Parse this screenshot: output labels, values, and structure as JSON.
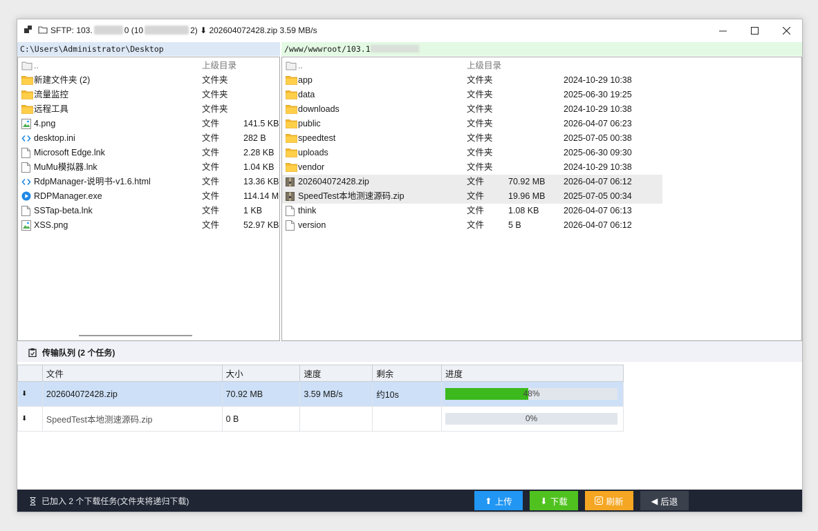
{
  "window": {
    "title_prefix": "SFTP: 103.",
    "title_mid": "0 (10",
    "title_suffix": "2) ⬇ 202604072428.zip 3.59 MB/s",
    "minimize": "—",
    "maximize": "☐",
    "close": "✕"
  },
  "paths": {
    "local": "C:\\Users\\Administrator\\Desktop",
    "remote": "/www/wwwroot/103.1"
  },
  "local_files": [
    {
      "name": "..",
      "type": "上级目录",
      "size": "",
      "icon": "parent-folder-icon"
    },
    {
      "name": "新建文件夹 (2)",
      "type": "文件夹",
      "size": "",
      "icon": "folder-icon"
    },
    {
      "name": "流量监控",
      "type": "文件夹",
      "size": "",
      "icon": "folder-icon"
    },
    {
      "name": "远程工具",
      "type": "文件夹",
      "size": "",
      "icon": "folder-icon"
    },
    {
      "name": "4.png",
      "type": "文件",
      "size": "141.5 KB",
      "icon": "image-file-icon"
    },
    {
      "name": "desktop.ini",
      "type": "文件",
      "size": "282 B",
      "icon": "code-file-icon"
    },
    {
      "name": "Microsoft Edge.lnk",
      "type": "文件",
      "size": "2.28 KB",
      "icon": "file-icon"
    },
    {
      "name": "MuMu模拟器.lnk",
      "type": "文件",
      "size": "1.04 KB",
      "icon": "file-icon"
    },
    {
      "name": "RdpManager-说明书-v1.6.html",
      "type": "文件",
      "size": "13.36 KB",
      "icon": "code-file-icon"
    },
    {
      "name": "RDPManager.exe",
      "type": "文件",
      "size": "114.14 M",
      "icon": "exe-file-icon"
    },
    {
      "name": "SSTap-beta.lnk",
      "type": "文件",
      "size": "1 KB",
      "icon": "file-icon"
    },
    {
      "name": "XSS.png",
      "type": "文件",
      "size": "52.97 KB",
      "icon": "image-file-icon"
    }
  ],
  "remote_files": [
    {
      "name": "..",
      "type": "上级目录",
      "size": "",
      "date": "",
      "icon": "parent-folder-icon",
      "highlight": false
    },
    {
      "name": "app",
      "type": "文件夹",
      "size": "",
      "date": "2024-10-29 10:38",
      "icon": "folder-icon",
      "highlight": false
    },
    {
      "name": "data",
      "type": "文件夹",
      "size": "",
      "date": "2025-06-30 19:25",
      "icon": "folder-icon",
      "highlight": false
    },
    {
      "name": "downloads",
      "type": "文件夹",
      "size": "",
      "date": "2024-10-29 10:38",
      "icon": "folder-icon",
      "highlight": false
    },
    {
      "name": "public",
      "type": "文件夹",
      "size": "",
      "date": "2026-04-07 06:23",
      "icon": "folder-icon",
      "highlight": false
    },
    {
      "name": "speedtest",
      "type": "文件夹",
      "size": "",
      "date": "2025-07-05 00:38",
      "icon": "folder-icon",
      "highlight": false
    },
    {
      "name": "uploads",
      "type": "文件夹",
      "size": "",
      "date": "2025-06-30 09:30",
      "icon": "folder-icon",
      "highlight": false
    },
    {
      "name": "vendor",
      "type": "文件夹",
      "size": "",
      "date": "2024-10-29 10:38",
      "icon": "folder-icon",
      "highlight": false
    },
    {
      "name": "202604072428.zip",
      "type": "文件",
      "size": "70.92 MB",
      "date": "2026-04-07 06:12",
      "icon": "zip-file-icon",
      "highlight": true
    },
    {
      "name": "SpeedTest本地测速源码.zip",
      "type": "文件",
      "size": "19.96 MB",
      "date": "2025-07-05 00:34",
      "icon": "zip-file-icon",
      "highlight": true
    },
    {
      "name": "think",
      "type": "文件",
      "size": "1.08 KB",
      "date": "2026-04-07 06:13",
      "icon": "file-icon",
      "highlight": false
    },
    {
      "name": "version",
      "type": "文件",
      "size": "5 B",
      "date": "2026-04-07 06:12",
      "icon": "file-icon",
      "highlight": false
    }
  ],
  "queue": {
    "title": "传输队列 (2 个任务)",
    "columns": [
      "",
      "文件",
      "大小",
      "速度",
      "剩余",
      "进度"
    ],
    "rows": [
      {
        "dir": "⬇",
        "file": "202604072428.zip",
        "size": "70.92 MB",
        "speed": "3.59 MB/s",
        "remaining": "约10s",
        "progress": 0.48,
        "progress_label": "48%",
        "selected": true
      },
      {
        "dir": "⬇",
        "file": "SpeedTest本地测速源码.zip",
        "size": "0 B",
        "speed": "",
        "remaining": "",
        "progress": 0,
        "progress_label": "0%",
        "selected": false
      }
    ]
  },
  "status": {
    "message": "已加入 2 个下载任务(文件夹将递归下载)",
    "icon": "hourglass-icon"
  },
  "buttons": {
    "upload": "上传",
    "download": "下载",
    "refresh": "刷新",
    "back": "后退"
  },
  "colors": {
    "upload": "#2196f3",
    "download": "#50c21f",
    "refresh": "#f5a623",
    "back": "#3a404c",
    "progress": "#3cb91c",
    "statusbar": "#1f2533",
    "local_path_bg": "#dde8f6",
    "remote_path_bg": "#e3f9e3"
  }
}
